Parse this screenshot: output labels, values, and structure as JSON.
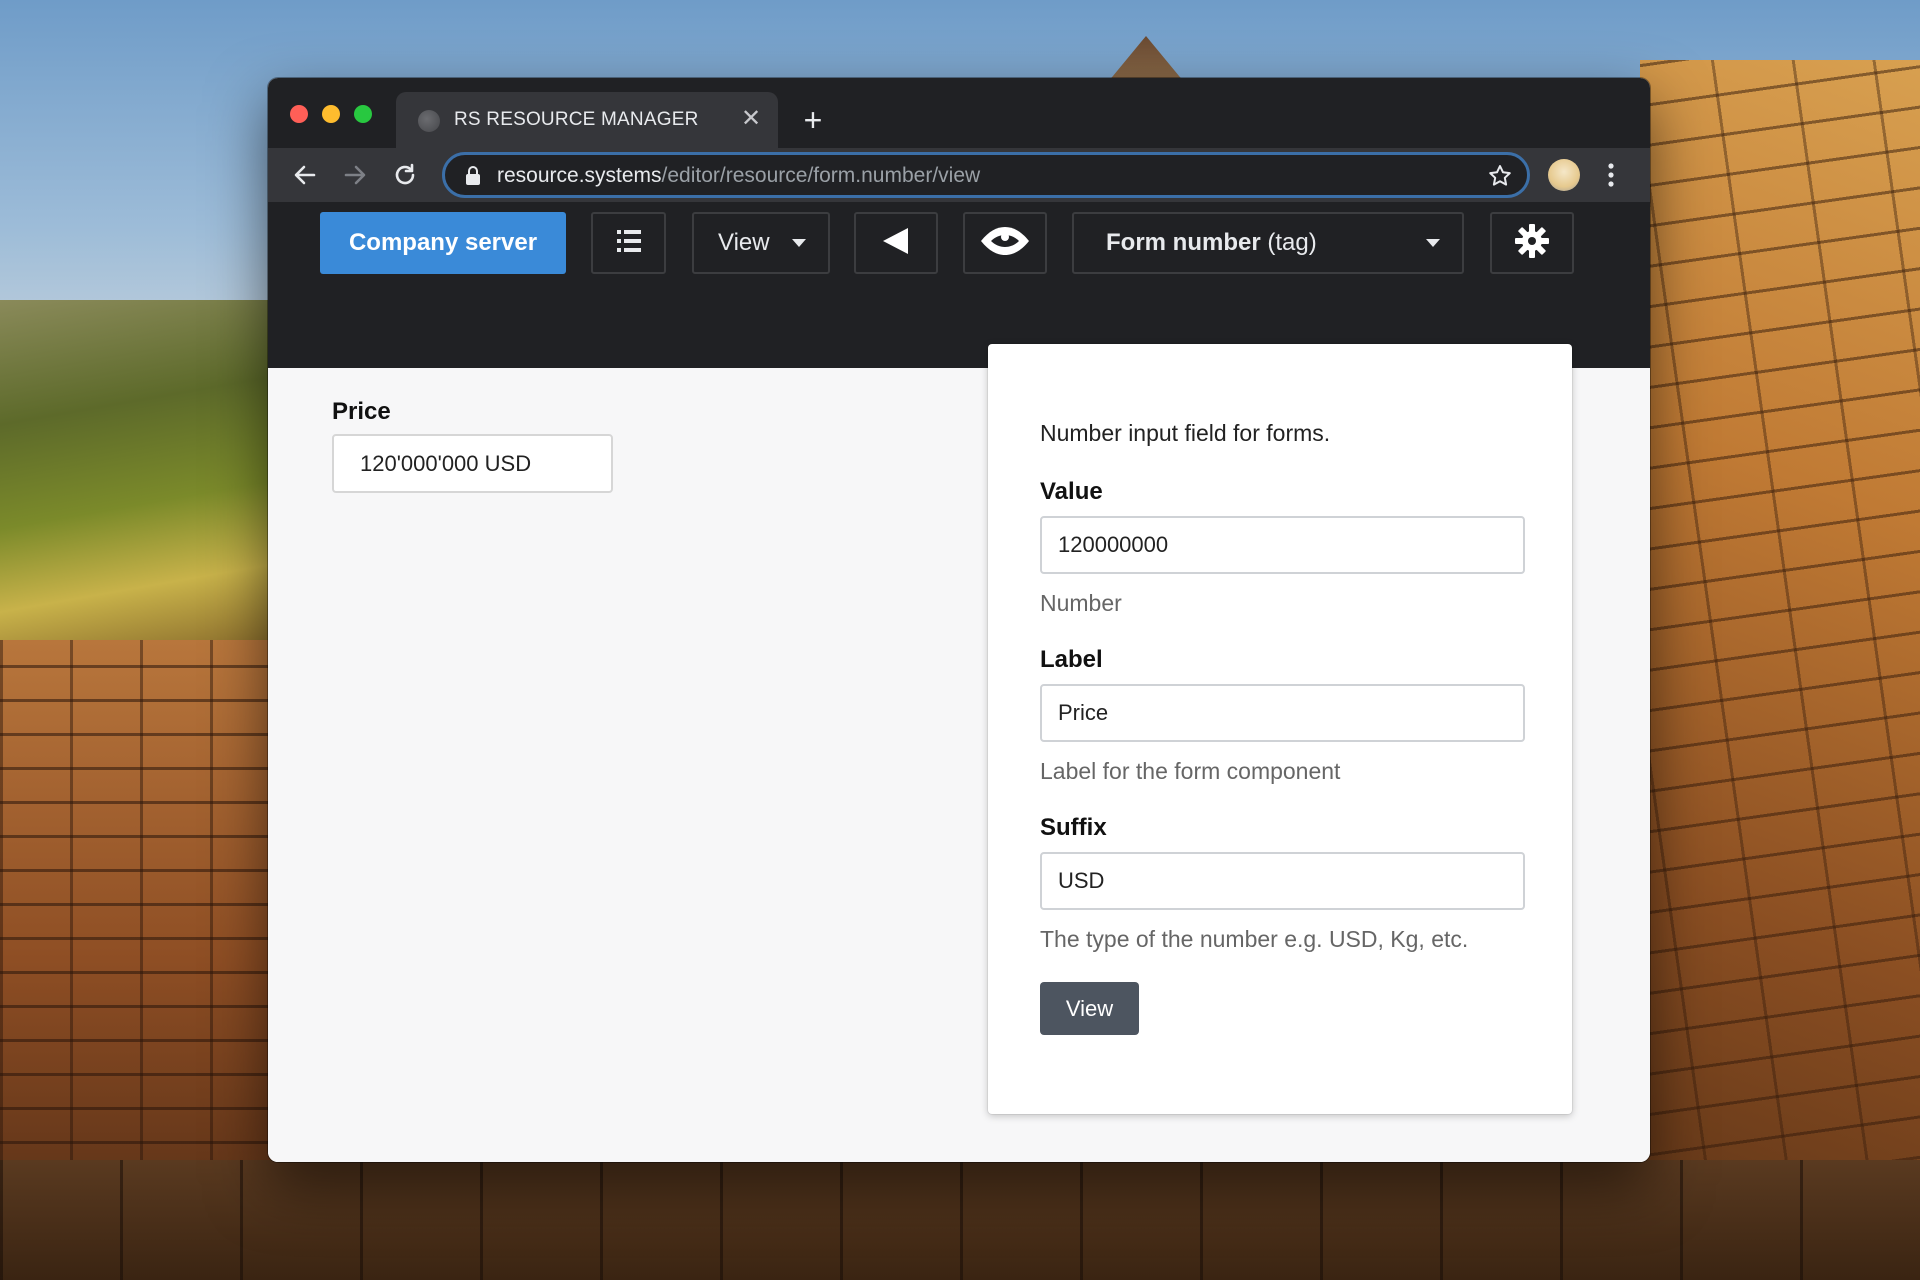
{
  "browser": {
    "tab_title": "RS RESOURCE MANAGER",
    "tab_close": "✕",
    "new_tab": "+",
    "url_host": "resource.systems",
    "url_path": "/editor/resource/form.number/view"
  },
  "header": {
    "company_button": "Company server",
    "view_dropdown": "View",
    "form_select_name": "Form number",
    "form_select_tag": " (tag)"
  },
  "main": {
    "price_label": "Price",
    "price_value": "120'000'000 USD"
  },
  "panel": {
    "description": "Number input field for forms.",
    "value_label": "Value",
    "value_input": "120000000",
    "value_help": "Number",
    "label_label": "Label",
    "label_input": "Price",
    "label_help": "Label for the form component",
    "suffix_label": "Suffix",
    "suffix_input": "USD",
    "suffix_help": "The type of the number e.g. USD, Kg, etc.",
    "view_button": "View"
  },
  "colors": {
    "accent": "#3a8ad8",
    "header_bg": "#202124",
    "panel_button": "#4d5560"
  },
  "icons": [
    "globe-icon",
    "close-icon",
    "plus-icon",
    "back-arrow-icon",
    "forward-arrow-icon",
    "reload-icon",
    "lock-icon",
    "star-icon",
    "avatar",
    "more-vert-icon",
    "list-icon",
    "chevron-down-icon",
    "triangle-left-icon",
    "eye-icon",
    "gear-icon"
  ]
}
